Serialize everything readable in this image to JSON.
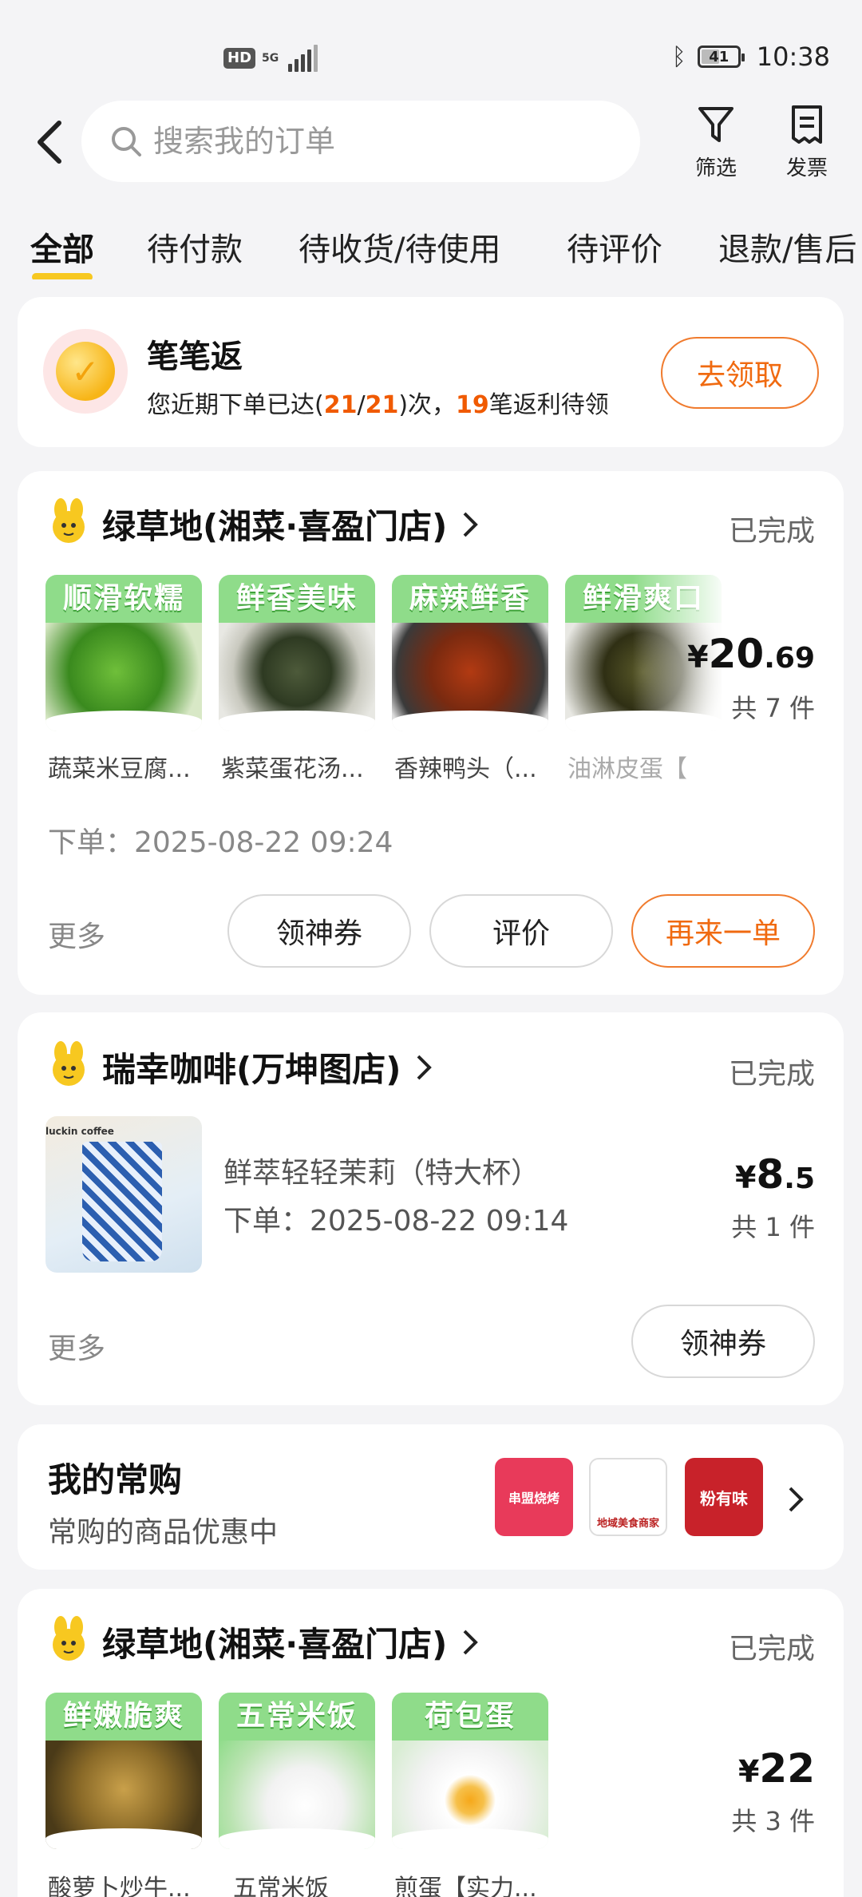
{
  "status_bar": {
    "hd": "HD",
    "network": "5G",
    "battery": "41",
    "time": "10:38"
  },
  "header": {
    "search_placeholder": "搜索我的订单",
    "filter_label": "筛选",
    "invoice_label": "发票"
  },
  "tabs": [
    "全部",
    "待付款",
    "待收货/待使用",
    "待评价",
    "退款/售后"
  ],
  "rebate": {
    "title": "笔笔返",
    "desc_prefix": "您近期下单已达(",
    "count_a": "21",
    "slash": "/",
    "count_b": "21",
    "desc_mid": ")次，",
    "pending": "19",
    "desc_suffix": "笔返利待领",
    "button": "去领取"
  },
  "orders": [
    {
      "store": "绿草地(湘菜·喜盈门店)",
      "status": "已完成",
      "items": [
        {
          "banner": "顺滑软糯",
          "name": "蔬菜米豆腐..."
        },
        {
          "banner": "鲜香美味",
          "name": "紫菜蛋花汤..."
        },
        {
          "banner": "麻辣鲜香",
          "name": "香辣鸭头（..."
        },
        {
          "banner": "鲜滑爽口",
          "name": "油淋皮蛋【"
        }
      ],
      "price_currency": "¥",
      "price_int": "20",
      "price_dec": ".69",
      "quantity": "共 7 件",
      "date": "下单：2025-08-22 09:24",
      "more": "更多",
      "actions": [
        "领神券",
        "评价",
        "再来一单"
      ]
    },
    {
      "store": "瑞幸咖啡(万坤图店)",
      "status": "已完成",
      "item_name": "鲜萃轻轻茉莉（特大杯）",
      "date": "下单：2025-08-22 09:14",
      "cup_text": "luckin coffee",
      "price_currency": "¥",
      "price_int": "8",
      "price_dec": ".5",
      "quantity": "共 1 件",
      "more": "更多",
      "actions": [
        "领神券"
      ]
    },
    {
      "store": "绿草地(湘菜·喜盈门店)",
      "status": "已完成",
      "items": [
        {
          "banner": "鲜嫩脆爽",
          "name": "酸萝卜炒牛..."
        },
        {
          "banner": "五常米饭",
          "name": "五常米饭"
        },
        {
          "banner": "荷包蛋",
          "name": "煎蛋【实力..."
        }
      ],
      "price_currency": "¥",
      "price_int": "22",
      "price_dec": "",
      "quantity": "共 3 件"
    }
  ],
  "favorites": {
    "title": "我的常购",
    "subtitle": "常购的商品优惠中",
    "logos": [
      "串盟烧烤",
      "地域美食商家",
      "粉有味"
    ]
  },
  "colors": {
    "accent_orange": "#f06a10",
    "tab_underline": "#f7c820",
    "banner_green": "#8fdc8a"
  }
}
